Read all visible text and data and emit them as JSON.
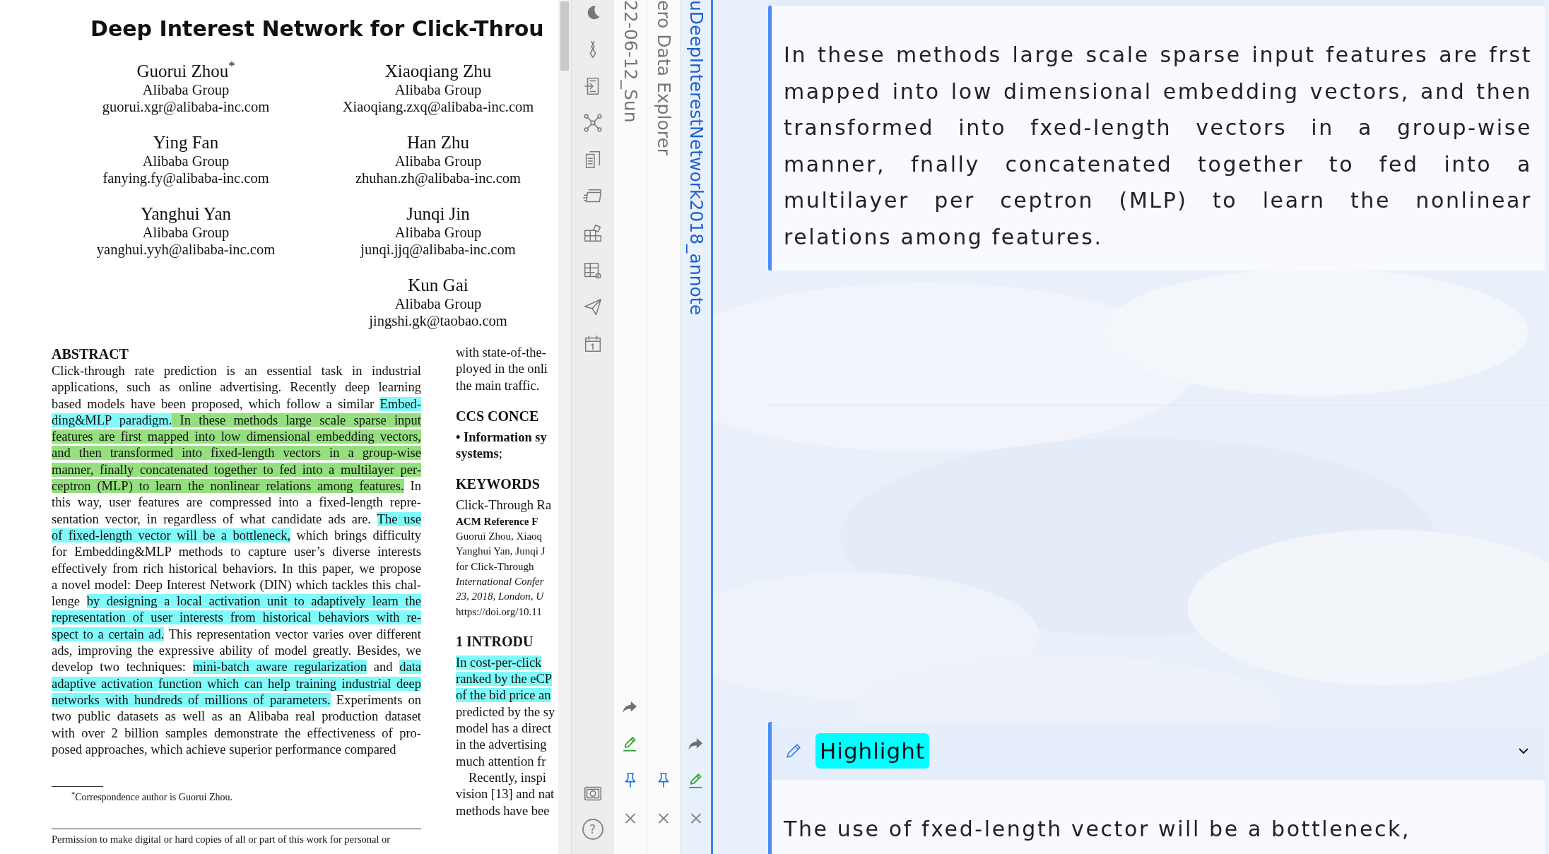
{
  "pdf": {
    "title": "Deep Interest Network for Click-Throu",
    "authors": [
      {
        "name": "Guorui Zhou$^{*}$",
        "affiliation": "Alibaba Group",
        "email": "guorui.xgr@alibaba-inc.com"
      },
      {
        "name": "Xiaoqiang Zhu",
        "affiliation": "Alibaba Group",
        "email": "Xiaoqiang.zxq@alibaba-inc.com"
      },
      {
        "name": "Ying Fan",
        "affiliation": "Alibaba Group",
        "email": "fanying.fy@alibaba-inc.com"
      },
      {
        "name": "Han Zhu",
        "affiliation": "Alibaba Group",
        "email": "zhuhan.zh@alibaba-inc.com"
      },
      {
        "name": "Yanghui Yan",
        "affiliation": "Alibaba Group",
        "email": "yanghui.yyh@alibaba-inc.com"
      },
      {
        "name": "Junqi Jin",
        "affiliation": "Alibaba Group",
        "email": "junqi.jjq@alibaba-inc.com"
      },
      {
        "name": "Kun Gai",
        "affiliation": "Alibaba Group",
        "email": "jingshi.gk@taobao.com"
      }
    ],
    "abstract_heading": "ABSTRACT",
    "abstract_lines": [
      [
        {
          "text": "Click-through rate prediction is an essential task in industrial"
        }
      ],
      [
        {
          "text": "applications, such as online advertising. Recently deep learning"
        }
      ],
      [
        {
          "text": "based models have been proposed, which follow a similar "
        },
        {
          "text": "Embed-",
          "color": "#80fafb"
        }
      ],
      [
        {
          "text": "ding&MLP paradigm.",
          "color": "#80fafb"
        },
        {
          "text": " In these methods large scale sparse input",
          "color": "#95e07e"
        }
      ],
      [
        {
          "text": "features are first mapped into low dimensional embedding vectors,",
          "color": "#95e07e"
        }
      ],
      [
        {
          "text": "and then transformed into fixed-length vectors in a group-wise",
          "color": "#95e07e"
        }
      ],
      [
        {
          "text": "manner, finally concatenated together to fed into a multilayer per-",
          "color": "#95e07e"
        }
      ],
      [
        {
          "text": "ceptron (MLP) to learn the nonlinear relations among features.",
          "color": "#95e07e"
        },
        {
          "text": " In"
        }
      ],
      [
        {
          "text": "this way, user features are compressed into a fixed-length repre-"
        }
      ],
      [
        {
          "text": "sentation vector, in regardless of what candidate ads are. "
        },
        {
          "text": "The use",
          "color": "#80fafb"
        }
      ],
      [
        {
          "text": "of fixed-length vector will be a bottleneck,",
          "color": "#80fafb"
        },
        {
          "text": " which brings difficulty"
        }
      ],
      [
        {
          "text": "for Embedding&MLP methods to capture user’s diverse interests"
        }
      ],
      [
        {
          "text": "effectively from rich historical behaviors. In this paper, we propose"
        }
      ],
      [
        {
          "text": "a novel model: Deep Interest Network (DIN) which tackles this chal-"
        }
      ],
      [
        {
          "text": "lenge "
        },
        {
          "text": "by designing a local activation unit to adaptively learn the",
          "color": "#80fafb"
        }
      ],
      [
        {
          "text": "representation of user interests from historical behaviors with re-",
          "color": "#80fafb"
        }
      ],
      [
        {
          "text": "spect to a certain ad.",
          "color": "#80fafb"
        },
        {
          "text": " This representation vector varies over different"
        }
      ],
      [
        {
          "text": "ads, improving the expressive ability of model greatly. Besides, we"
        }
      ],
      [
        {
          "text": "develop two techniques: "
        },
        {
          "text": "mini-batch aware regularization",
          "color": "#80fafb"
        },
        {
          "text": " and "
        },
        {
          "text": "data",
          "color": "#80fafb"
        }
      ],
      [
        {
          "text": "adaptive activation function which can help training industrial deep",
          "color": "#80fafb"
        }
      ],
      [
        {
          "text": "networks with hundreds of millions of parameters.",
          "color": "#80fafb"
        },
        {
          "text": " Experiments on"
        }
      ],
      [
        {
          "text": "two public datasets as well as an Alibaba real production dataset"
        }
      ],
      [
        {
          "text": "with over 2 billion samples demonstrate the effectiveness of pro-"
        }
      ],
      [
        {
          "text": "posed approaches, which achieve superior performance compared"
        }
      ]
    ],
    "footnote": "$^{*}$Correspondence author is Guorui Zhou.",
    "permission": "Permission to make digital or hard copies of all or part of this work for personal or",
    "right_column": [
      {
        "kind": "text",
        "text": "with state-of-the-"
      },
      {
        "kind": "text",
        "text": "ployed in the onli"
      },
      {
        "kind": "text",
        "text": "the main traffic."
      },
      {
        "kind": "heading",
        "text": "CCS CONCE"
      },
      {
        "kind": "text",
        "text": "**• Information sy**"
      },
      {
        "kind": "text",
        "text": "**systems**;"
      },
      {
        "kind": "heading",
        "text": "KEYWORDS"
      },
      {
        "kind": "text",
        "text": "Click-Through Ra"
      },
      {
        "kind": "small",
        "text": "**ACM Reference F**"
      },
      {
        "kind": "small",
        "text": "Guorui Zhou, Xiaoq"
      },
      {
        "kind": "small",
        "text": "Yanghui Yan, Junqi J"
      },
      {
        "kind": "small",
        "text": "for Click-Through"
      },
      {
        "kind": "small",
        "text": "*International Confer*"
      },
      {
        "kind": "small",
        "text": "*23, 2018, London, U*"
      },
      {
        "kind": "small",
        "text": "https://doi.org/10.11"
      },
      {
        "kind": "heading",
        "text": "1   INTRODU"
      },
      {
        "kind": "highlight",
        "text": "In cost-per-click",
        "color": "#80fafb"
      },
      {
        "kind": "highlight",
        "text": "ranked by the eCP",
        "color": "#80fafb"
      },
      {
        "kind": "highlight",
        "text": "of the bid price an",
        "color": "#80fafb"
      },
      {
        "kind": "text",
        "text": "predicted by the sy"
      },
      {
        "kind": "text",
        "text": "model has a direct"
      },
      {
        "kind": "text",
        "text": "in the advertising"
      },
      {
        "kind": "text",
        "text": "much attention fr"
      },
      {
        "kind": "indent",
        "text": "Recently, inspi"
      },
      {
        "kind": "text",
        "text": "vision [13] and nat"
      },
      {
        "kind": "text",
        "text": "methods have bee"
      }
    ]
  },
  "toolbar": {
    "tools": [
      {
        "kind": "moon"
      },
      {
        "kind": "ribbon"
      },
      {
        "kind": "import"
      },
      {
        "kind": "nodes"
      },
      {
        "kind": "documents"
      },
      {
        "kind": "cards"
      },
      {
        "kind": "blocks"
      },
      {
        "kind": "tablegear"
      },
      {
        "kind": "send"
      },
      {
        "kind": "calendar"
      }
    ],
    "bottom": [
      {
        "kind": "safe"
      },
      {
        "kind": "help",
        "label": "?"
      }
    ]
  },
  "panels": [
    {
      "title": "22-06-12_Sun",
      "selected": false,
      "actions": [
        {
          "kind": "share"
        },
        {
          "kind": "edit"
        },
        {
          "kind": "pin"
        },
        {
          "kind": "close"
        }
      ]
    },
    {
      "title": "ero Data Explorer",
      "selected": false,
      "actions": [
        {
          "kind": "pin"
        },
        {
          "kind": "close"
        }
      ]
    },
    {
      "title": "uDeepInterestNetwork2018_annote",
      "selected": true,
      "actions": [
        {
          "kind": "share"
        },
        {
          "kind": "edit"
        },
        {
          "kind": "close"
        }
      ]
    }
  ],
  "annotations": [
    {
      "kind": "text",
      "text": "In these methods large scale sparse input features are frst mapped into low dimensional embedding vectors, and then transformed into fxed-length vectors in a group-wise manner, fnally concatenated together to fed into a multilayer per ceptron (MLP) to learn the nonlinear relations among features."
    },
    {
      "kind": "highlight",
      "label": "Highlight",
      "color": "#00ffff",
      "text": "The use of fxed-length vector will be a bottleneck,"
    }
  ]
}
